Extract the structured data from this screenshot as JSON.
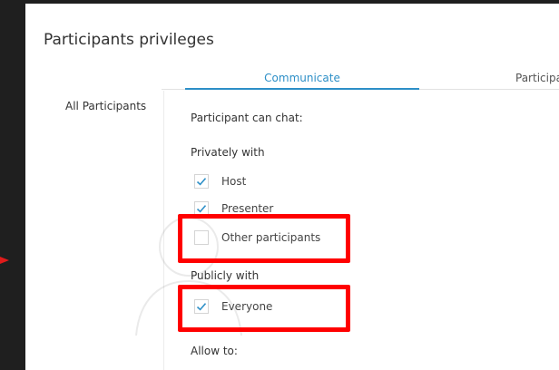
{
  "dialog": {
    "title": "Participants privileges"
  },
  "tabs": [
    {
      "label": "Communicate",
      "active": true
    },
    {
      "label": "Participa",
      "active": false
    }
  ],
  "sidebar": {
    "items": [
      {
        "label": "All Participants"
      }
    ]
  },
  "content": {
    "chat_heading": "Participant can chat:",
    "privately_heading": "Privately with",
    "privately_options": [
      {
        "label": "Host",
        "checked": true
      },
      {
        "label": "Presenter",
        "checked": true
      },
      {
        "label": "Other participants",
        "checked": false
      }
    ],
    "publicly_heading": "Publicly with",
    "publicly_options": [
      {
        "label": "Everyone",
        "checked": true
      }
    ],
    "allow_heading": "Allow to:"
  },
  "colors": {
    "accent": "#2d8fc7",
    "highlight": "#ff0000",
    "backdrop": "#1f1f1f"
  },
  "icons": [
    "checkmark-icon",
    "arrow-right-icon",
    "user-silhouette-icon"
  ]
}
